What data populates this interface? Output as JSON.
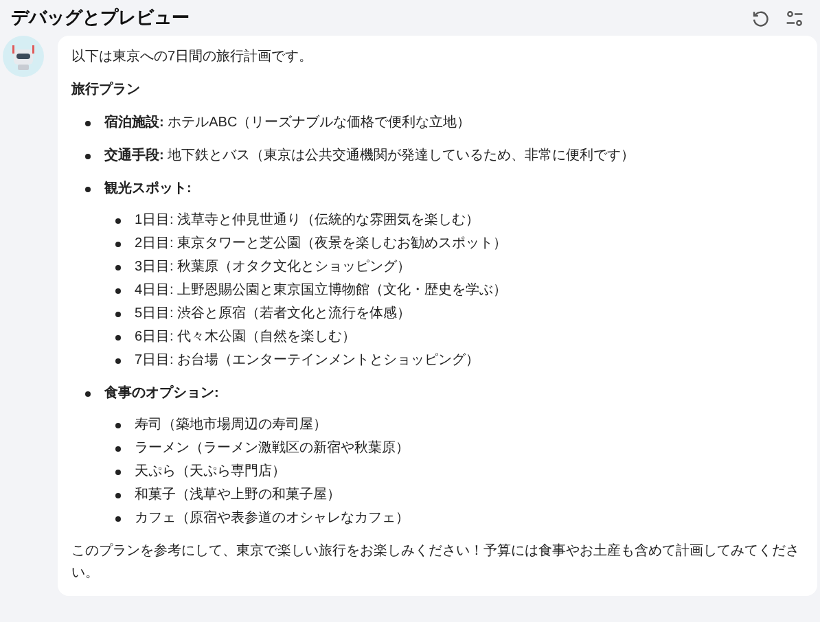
{
  "header": {
    "title": "デバッグとプレビュー"
  },
  "message": {
    "intro": "以下は東京への7日間の旅行計画です。",
    "heading": "旅行プラン",
    "sections": [
      {
        "label": "宿泊施設:",
        "detail": "ホテルABC（リーズナブルな価格で便利な立地）"
      },
      {
        "label": "交通手段:",
        "detail": "地下鉄とバス（東京は公共交通機関が発達しているため、非常に便利です）"
      },
      {
        "label": "観光スポット:",
        "items": [
          "1日目: 浅草寺と仲見世通り（伝統的な雰囲気を楽しむ）",
          "2日目: 東京タワーと芝公園（夜景を楽しむお勧めスポット）",
          "3日目: 秋葉原（オタク文化とショッピング）",
          "4日目: 上野恩賜公園と東京国立博物館（文化・歴史を学ぶ）",
          "5日目: 渋谷と原宿（若者文化と流行を体感）",
          "6日目: 代々木公園（自然を楽しむ）",
          "7日目: お台場（エンターテインメントとショッピング）"
        ]
      },
      {
        "label": "食事のオプション:",
        "items": [
          "寿司（築地市場周辺の寿司屋）",
          "ラーメン（ラーメン激戦区の新宿や秋葉原）",
          "天ぷら（天ぷら専門店）",
          "和菓子（浅草や上野の和菓子屋）",
          "カフェ（原宿や表参道のオシャレなカフェ）"
        ]
      }
    ],
    "closing": "このプランを参考にして、東京で楽しい旅行をお楽しみください！予算には食事やお土産も含めて計画してみてください。"
  }
}
